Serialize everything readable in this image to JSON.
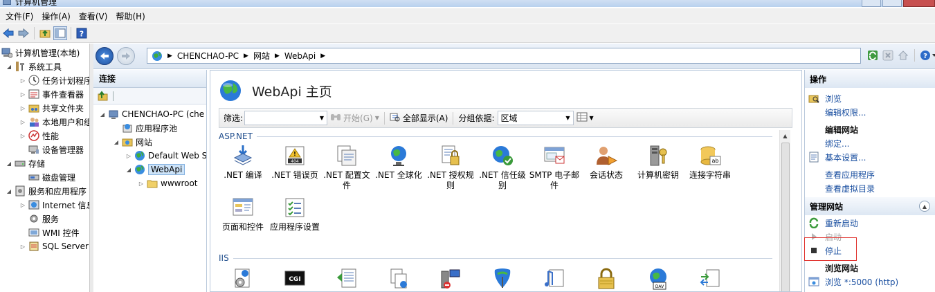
{
  "window": {
    "title": "计算机管理"
  },
  "menu": [
    "文件(F)",
    "操作(A)",
    "查看(V)",
    "帮助(H)"
  ],
  "left_tree": [
    {
      "label": "计算机管理(本地)",
      "level": 0,
      "expander": "",
      "icon": "computer-management-icon"
    },
    {
      "label": "系统工具",
      "level": 1,
      "expander": "◢",
      "icon": "system-tools-icon"
    },
    {
      "label": "任务计划程序",
      "level": 2,
      "expander": "▷",
      "icon": "task-scheduler-icon"
    },
    {
      "label": "事件查看器",
      "level": 2,
      "expander": "▷",
      "icon": "event-viewer-icon"
    },
    {
      "label": "共享文件夹",
      "level": 2,
      "expander": "▷",
      "icon": "shared-folder-icon"
    },
    {
      "label": "本地用户和组",
      "level": 2,
      "expander": "▷",
      "icon": "local-users-icon"
    },
    {
      "label": "性能",
      "level": 2,
      "expander": "▷",
      "icon": "performance-icon"
    },
    {
      "label": "设备管理器",
      "level": 2,
      "expander": "",
      "icon": "device-manager-icon"
    },
    {
      "label": "存储",
      "level": 1,
      "expander": "◢",
      "icon": "storage-icon"
    },
    {
      "label": "磁盘管理",
      "level": 2,
      "expander": "",
      "icon": "disk-management-icon"
    },
    {
      "label": "服务和应用程序",
      "level": 1,
      "expander": "◢",
      "icon": "services-apps-icon"
    },
    {
      "label": "Internet 信息服务",
      "level": 2,
      "expander": "▷",
      "icon": "iis-icon"
    },
    {
      "label": "服务",
      "level": 2,
      "expander": "",
      "icon": "services-icon"
    },
    {
      "label": "WMI 控件",
      "level": 2,
      "expander": "",
      "icon": "wmi-icon"
    },
    {
      "label": "SQL Server",
      "level": 2,
      "expander": "▷",
      "icon": "sql-server-icon"
    }
  ],
  "address": {
    "crumbs": [
      "CHENCHAO-PC",
      "网站",
      "WebApi"
    ]
  },
  "connections": {
    "header": "连接",
    "tree": [
      {
        "label": "CHENCHAO-PC (che",
        "indent": 0,
        "expander": "◢",
        "icon": "server-icon"
      },
      {
        "label": "应用程序池",
        "indent": 1,
        "expander": "",
        "icon": "app-pool-icon"
      },
      {
        "label": "网站",
        "indent": 1,
        "expander": "◢",
        "icon": "sites-folder-icon"
      },
      {
        "label": "Default Web S",
        "indent": 2,
        "expander": "▷",
        "icon": "globe-icon"
      },
      {
        "label": "WebApi",
        "indent": 2,
        "expander": "◢",
        "icon": "globe-icon",
        "selected": true
      },
      {
        "label": "wwwroot",
        "indent": 3,
        "expander": "▷",
        "icon": "folder-icon"
      }
    ]
  },
  "main": {
    "title": "WebApi 主页",
    "filter": {
      "label": "筛选:",
      "go": "开始(G)",
      "show_all": "全部显示(A)",
      "group_label": "分组依据:",
      "group_value": "区域"
    },
    "groups": [
      {
        "name": "ASP.NET",
        "features": [
          {
            "label": ".NET 编译",
            "icon": "net-compile-icon"
          },
          {
            "label": ".NET 错误页",
            "icon": "net-error-page-icon"
          },
          {
            "label": ".NET 配置文件",
            "icon": "net-profile-icon"
          },
          {
            "label": ".NET 全球化",
            "icon": "net-globalization-icon"
          },
          {
            "label": ".NET 授权规则",
            "icon": "net-authorization-icon"
          },
          {
            "label": ".NET 信任级别",
            "icon": "net-trust-level-icon"
          },
          {
            "label": "SMTP 电子邮件",
            "icon": "smtp-email-icon"
          },
          {
            "label": "会话状态",
            "icon": "session-state-icon"
          },
          {
            "label": "计算机密钥",
            "icon": "machine-key-icon"
          },
          {
            "label": "连接字符串",
            "icon": "connection-strings-icon"
          },
          {
            "label": "页面和控件",
            "icon": "pages-controls-icon"
          },
          {
            "label": "应用程序设置",
            "icon": "app-settings-icon"
          }
        ]
      },
      {
        "name": "IIS",
        "features": [
          {
            "label": "",
            "icon": "asp-icon"
          },
          {
            "label": "",
            "icon": "cgi-icon"
          },
          {
            "label": "",
            "icon": "compression-icon"
          },
          {
            "label": "",
            "icon": "default-document-icon"
          },
          {
            "label": "",
            "icon": "directory-browsing-icon"
          },
          {
            "label": "",
            "icon": "error-pages-icon"
          },
          {
            "label": "",
            "icon": "handler-mappings-icon"
          },
          {
            "label": "",
            "icon": "authentication-lock-icon"
          },
          {
            "label": "",
            "icon": "webdav-icon"
          },
          {
            "label": "",
            "icon": "url-rewrite-icon"
          }
        ]
      }
    ]
  },
  "actions": {
    "header": "操作",
    "browse": "浏览",
    "edit_perms": "编辑权限...",
    "edit_site": "编辑网站",
    "bind": "绑定...",
    "basic_settings": "基本设置...",
    "view_apps": "查看应用程序",
    "view_vdirs": "查看虚拟目录",
    "manage_site": "管理网站",
    "restart": "重新启动",
    "start": "启动",
    "stop": "停止",
    "browse_site": "浏览网站",
    "browse_port": "浏览 *:5000 (http)"
  }
}
